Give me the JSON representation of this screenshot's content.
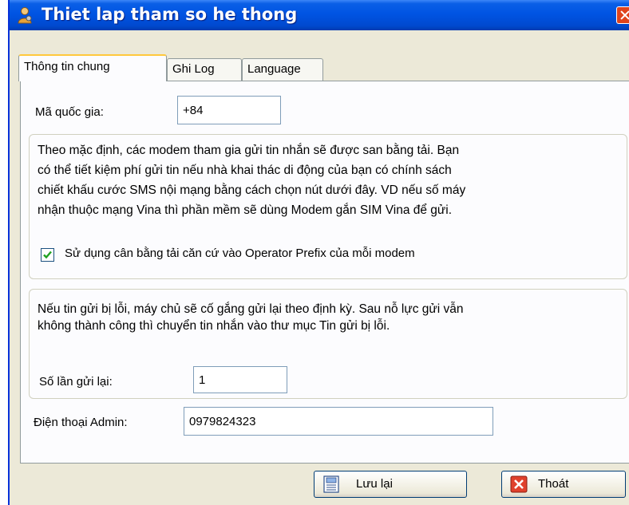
{
  "window": {
    "title": "Thiet lap tham so he thong"
  },
  "tabs": [
    {
      "label": "Thông tin chung",
      "active": true
    },
    {
      "label": "Ghi Log",
      "active": false
    },
    {
      "label": "Language",
      "active": false
    }
  ],
  "general": {
    "country_code_label": "Mã quốc gia:",
    "country_code_value": "+84",
    "load_balance_group": {
      "description": "Theo mặc định, các modem tham gia gửi tin nhắn sẽ được san bằng tải. Bạn\ncó thể tiết kiệm phí gửi tin nếu nhà khai thác di động của bạn có chính sách\nchiết khấu cước SMS nội mạng bằng cách chọn nút dưới đây. VD nếu số máy\nnhận thuộc mạng Vina thì phần mềm sẽ dùng Modem gắn SIM Vina để gửi.",
      "checkbox_label": "Sử dụng cân bằng tải căn cứ vào Operator Prefix của mỗi modem",
      "checkbox_checked": true
    },
    "retry_group": {
      "description": "Nếu tin gửi bị lỗi, máy chủ sẽ cố gắng gửi lại theo định kỳ. Sau nỗ lực gửi vẫn\nkhông thành công thì chuyển tin nhắn vào thư mục Tin gửi bị lỗi.",
      "retry_label": "Số lần gửi lại:",
      "retry_value": "1"
    },
    "admin_phone_label": "Điện thoại Admin:",
    "admin_phone_value": "0979824323"
  },
  "buttons": {
    "save_label": "Lưu lại",
    "exit_label": "Thoát"
  },
  "colors": {
    "title_bar": "#0054e3",
    "window_bg": "#ece9d8",
    "tab_highlight": "#ffc83c",
    "check_green": "#21a121",
    "exit_icon_red": "#e0412c"
  },
  "icons": {
    "app": "settings-user-icon",
    "close": "close-icon",
    "checkbox": "checkmark-icon",
    "save": "save-document-icon",
    "exit": "exit-x-icon"
  }
}
